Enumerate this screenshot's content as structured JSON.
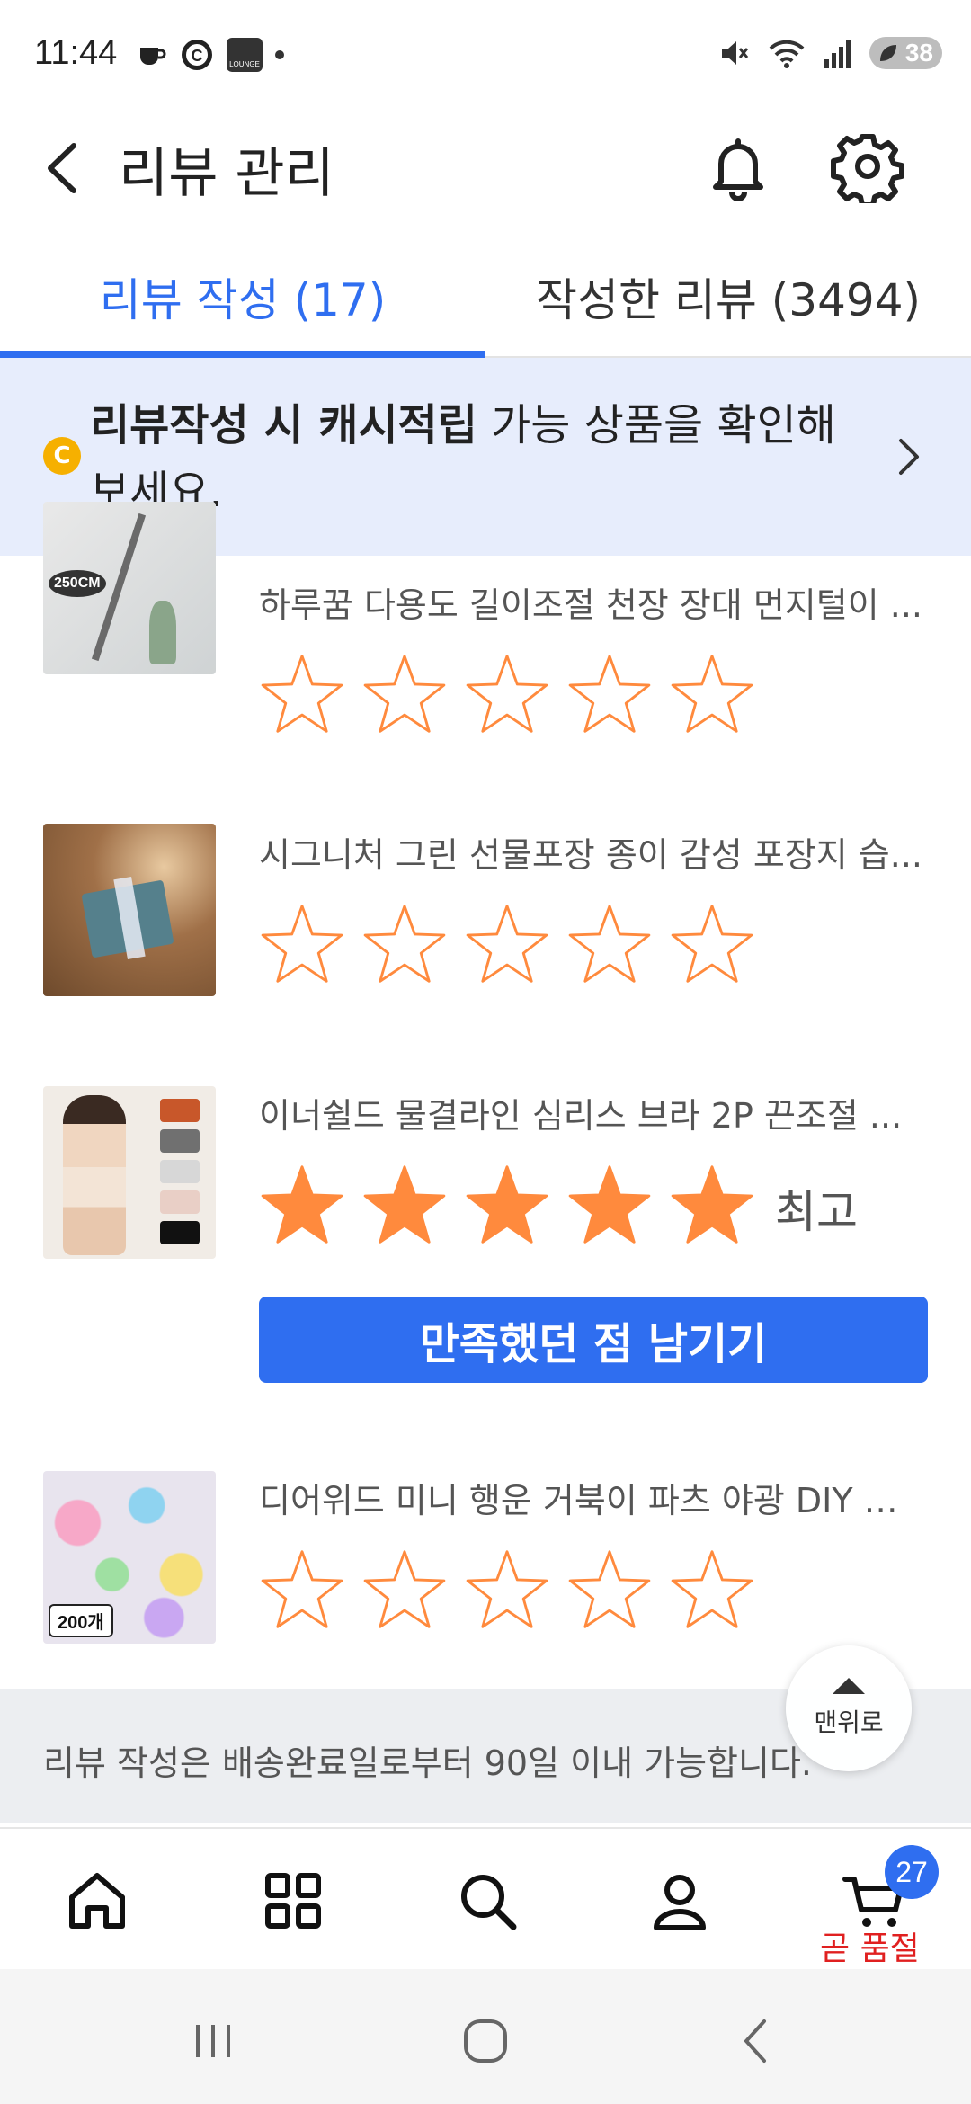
{
  "status_bar": {
    "time": "11:44",
    "battery": "38",
    "lounge_label": "LOUNGE"
  },
  "header": {
    "title": "리뷰 관리"
  },
  "tabs": [
    {
      "label": "리뷰 작성 (17)",
      "active": true
    },
    {
      "label": "작성한 리뷰 (3494)",
      "active": false
    }
  ],
  "banner": {
    "icon": "C",
    "bold_text": "리뷰작성 시 캐시적립",
    "text": " 가능 상품을 확인해보세요."
  },
  "items": [
    {
      "name": "하루꿈 다용도 길이조절 천장 장대 먼지털이 ...",
      "rating": 0,
      "rating_label": "",
      "thumb_badge": "250CM"
    },
    {
      "name": "시그니처 그린 선물포장 종이 감성 포장지 습...",
      "rating": 0,
      "rating_label": ""
    },
    {
      "name": "이너쉴드 물결라인 심리스 브라 2P 끈조절 ...",
      "rating": 5,
      "rating_label": "최고",
      "button_label": "만족했던 점 남기기"
    },
    {
      "name": "디어위드 미니 행운 거북이 파츠 야광 DIY 레...",
      "rating": 0,
      "rating_label": "",
      "thumb_badge": "200개"
    }
  ],
  "notice": {
    "text": "리뷰 작성은 배송완료일로부터 90일 이내 가능합니다."
  },
  "scroll_top": {
    "label": "맨위로"
  },
  "bottom_nav": {
    "items": [
      "home-icon",
      "category-icon",
      "search-icon",
      "mypage-icon",
      "cart-icon"
    ],
    "cart_count": "27",
    "cart_label": "곧 품절"
  },
  "colors": {
    "accent": "#2f6ef0",
    "star": "#ff8a3d",
    "banner_bg": "#e7edfc",
    "alert": "#e02020"
  }
}
